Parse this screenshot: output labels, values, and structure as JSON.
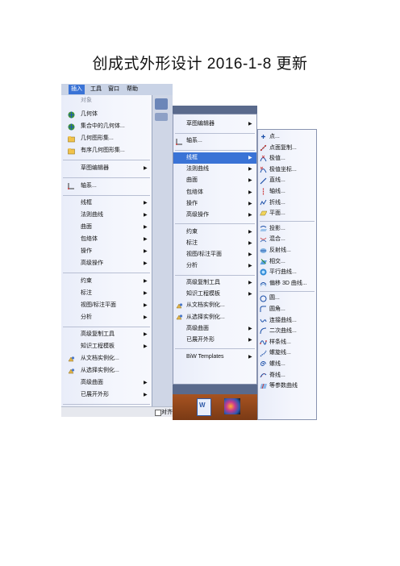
{
  "title": "创成式外形设计 2016-1-8 更新",
  "menubar": {
    "items": [
      "插入",
      "工具",
      "窗口",
      "帮助"
    ]
  },
  "panel1": {
    "header": "对象",
    "items": [
      {
        "label": "几何体",
        "arrow": false,
        "icon": "globe-icon"
      },
      {
        "label": "集合中的几何体...",
        "arrow": false,
        "icon": "globe-icon"
      },
      {
        "label": "几何图形集...",
        "arrow": false,
        "icon": "folder-icon"
      },
      {
        "label": "有序几何图形集...",
        "arrow": false,
        "icon": "folder-icon"
      },
      {
        "sep": true
      },
      {
        "label": "草图编辑器",
        "arrow": true
      },
      {
        "sep": true
      },
      {
        "label": "轴系...",
        "arrow": false,
        "icon": "axis-icon"
      },
      {
        "sep": true
      },
      {
        "label": "线框",
        "arrow": true
      },
      {
        "label": "法则曲线",
        "arrow": true
      },
      {
        "label": "曲面",
        "arrow": true
      },
      {
        "label": "包络体",
        "arrow": true
      },
      {
        "label": "操作",
        "arrow": true
      },
      {
        "label": "高级操作",
        "arrow": true
      },
      {
        "sep": true
      },
      {
        "label": "约束",
        "arrow": true
      },
      {
        "label": "标注",
        "arrow": true
      },
      {
        "label": "视图/标注平面",
        "arrow": true
      },
      {
        "label": "分析",
        "arrow": true
      },
      {
        "sep": true
      },
      {
        "label": "高级复制工具",
        "arrow": true
      },
      {
        "label": "知识工程模板",
        "arrow": true
      },
      {
        "label": "从文档实例化...",
        "arrow": false,
        "icon": "instantiate-icon"
      },
      {
        "label": "从选择实例化...",
        "arrow": false,
        "icon": "instantiate-icon"
      },
      {
        "label": "高级曲面",
        "arrow": true
      },
      {
        "label": "已展开外形",
        "arrow": true
      },
      {
        "sep": true
      },
      {
        "label": "BiW Templates",
        "arrow": true
      }
    ],
    "bottom_text": "对齐"
  },
  "panel2": {
    "items": [
      {
        "label": "草图编辑器",
        "arrow": true
      },
      {
        "sep": true
      },
      {
        "label": "轴系...",
        "arrow": false,
        "icon": "axis-icon"
      },
      {
        "sep": true
      },
      {
        "label": "线框",
        "arrow": true,
        "highlight": true
      },
      {
        "label": "法则曲线",
        "arrow": true
      },
      {
        "label": "曲面",
        "arrow": true
      },
      {
        "label": "包络体",
        "arrow": true
      },
      {
        "label": "操作",
        "arrow": true
      },
      {
        "label": "高级操作",
        "arrow": true
      },
      {
        "sep": true
      },
      {
        "label": "约束",
        "arrow": true
      },
      {
        "label": "标注",
        "arrow": true
      },
      {
        "label": "视图/标注平面",
        "arrow": true
      },
      {
        "label": "分析",
        "arrow": true
      },
      {
        "sep": true
      },
      {
        "label": "高级复制工具",
        "arrow": true
      },
      {
        "label": "知识工程模板",
        "arrow": true
      },
      {
        "label": "从文档实例化...",
        "arrow": false,
        "icon": "instantiate-icon"
      },
      {
        "label": "从选择实例化...",
        "arrow": false,
        "icon": "instantiate-icon"
      },
      {
        "label": "高级曲面",
        "arrow": true
      },
      {
        "label": "已展开外形",
        "arrow": true
      },
      {
        "sep": true
      },
      {
        "label": "BiW Templates",
        "arrow": true
      }
    ]
  },
  "panel3": {
    "items": [
      {
        "label": "点...",
        "icon": "point-icon"
      },
      {
        "label": "点面复制...",
        "icon": "points-planes-repetition-icon"
      },
      {
        "label": "极值...",
        "icon": "extremum-icon"
      },
      {
        "label": "极值坐标...",
        "icon": "extremum-polar-icon"
      },
      {
        "label": "直线...",
        "icon": "line-icon"
      },
      {
        "label": "轴线...",
        "icon": "axis-line-icon"
      },
      {
        "label": "折线...",
        "icon": "polyline-icon"
      },
      {
        "label": "平面...",
        "icon": "plane-icon"
      },
      {
        "sep": true
      },
      {
        "label": "投影...",
        "icon": "projection-icon"
      },
      {
        "label": "混合...",
        "icon": "combine-icon"
      },
      {
        "label": "反射线...",
        "icon": "reflect-lines-icon"
      },
      {
        "label": "相交...",
        "icon": "intersection-icon"
      },
      {
        "label": "平行曲线...",
        "icon": "parallel-curve-icon"
      },
      {
        "label": "偏移 3D 曲线...",
        "icon": "offset-3d-curve-icon"
      },
      {
        "sep": true
      },
      {
        "label": "圆...",
        "icon": "circle-icon"
      },
      {
        "label": "圆角...",
        "icon": "corner-icon"
      },
      {
        "label": "连接曲线...",
        "icon": "connect-curve-icon"
      },
      {
        "label": "二次曲线...",
        "icon": "conic-icon"
      },
      {
        "label": "样条线...",
        "icon": "spline-icon"
      },
      {
        "label": "螺旋线...",
        "icon": "helix-icon"
      },
      {
        "label": "螺线...",
        "icon": "spiral-icon"
      },
      {
        "label": "脊线...",
        "icon": "spine-icon"
      },
      {
        "label": "等参数曲线",
        "icon": "isoparametric-curve-icon"
      }
    ]
  },
  "colors": {
    "highlight": "#3a73d6",
    "menu_bg": "#eef1fb",
    "toolbar": "#5a6a8c"
  }
}
